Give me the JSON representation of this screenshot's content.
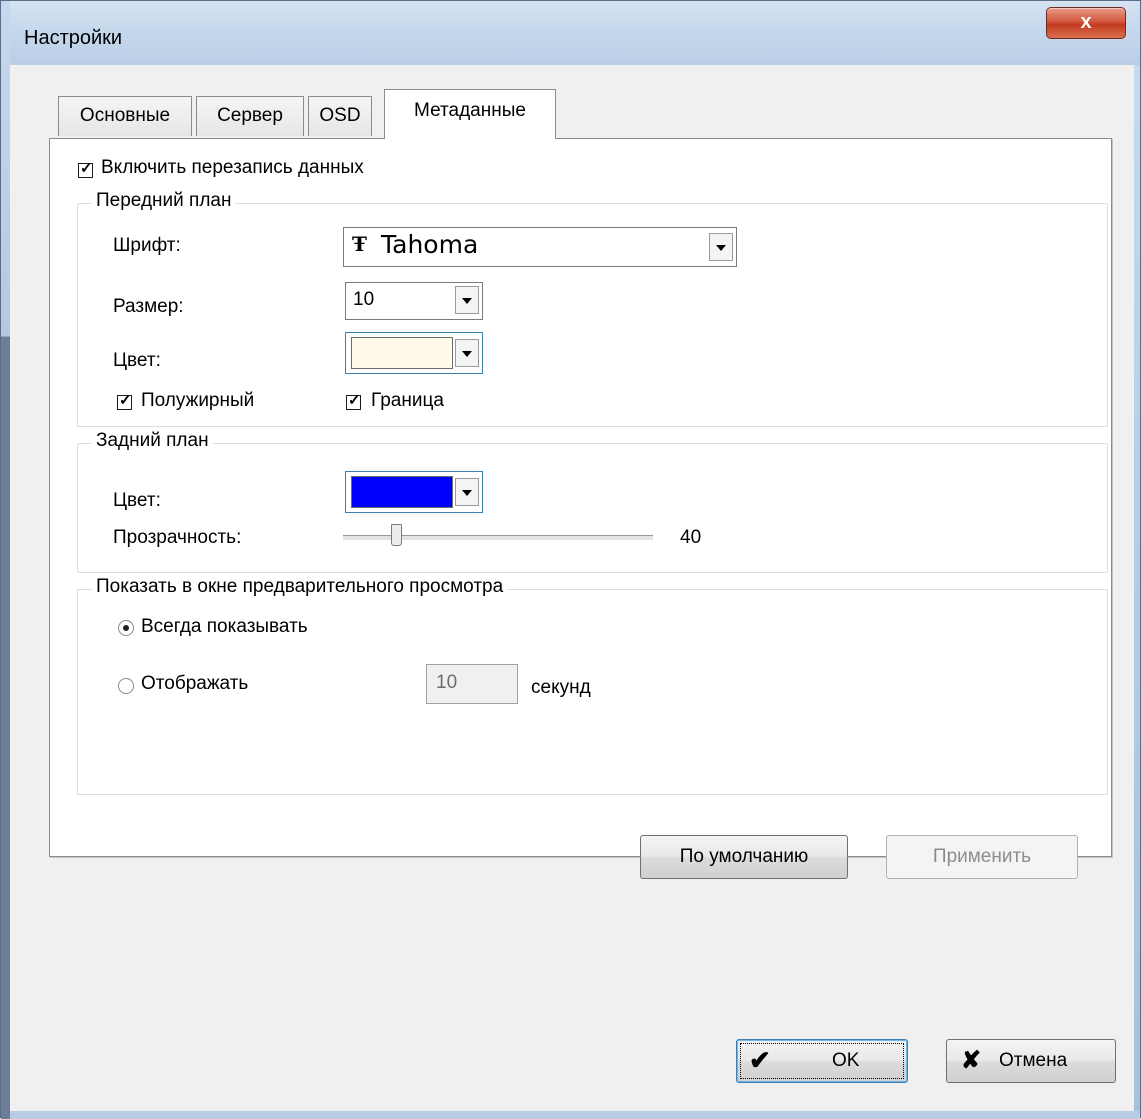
{
  "window": {
    "title": "Настройки",
    "close_glyph": "x"
  },
  "tabs": [
    {
      "label": "Основные",
      "selected": false
    },
    {
      "label": "Сервер",
      "selected": false
    },
    {
      "label": "OSD",
      "selected": false
    },
    {
      "label": "Метаданные",
      "selected": true
    }
  ],
  "metadata": {
    "enable_overwrite": {
      "label": "Включить перезапись данных",
      "checked": true
    },
    "foreground": {
      "title": "Передний план",
      "font_label": "Шрифт:",
      "font_value": "Tahoma",
      "font_icon_glyph": "Ŧ",
      "size_label": "Размер:",
      "size_value": "10",
      "color_label": "Цвет:",
      "color_value": "#fffbe8",
      "bold": {
        "label": "Полужирный",
        "checked": true
      },
      "border": {
        "label": "Граница",
        "checked": true
      }
    },
    "background": {
      "title": "Задний план",
      "color_label": "Цвет:",
      "color_value": "#0000ff",
      "transparency_label": "Прозрачность:",
      "transparency_value": "40"
    },
    "preview": {
      "title": "Показать в окне предварительного просмотра",
      "always_label": "Всегда показывать",
      "always_selected": true,
      "display_label": "Отображать",
      "display_selected": false,
      "seconds_value": "10",
      "seconds_label": "секунд"
    },
    "default_button": "По умолчанию",
    "apply_button": "Применить"
  },
  "footer": {
    "ok_label": "OK",
    "ok_icon_glyph": "✔",
    "cancel_label": "Отмена",
    "cancel_icon_glyph": "✘"
  }
}
